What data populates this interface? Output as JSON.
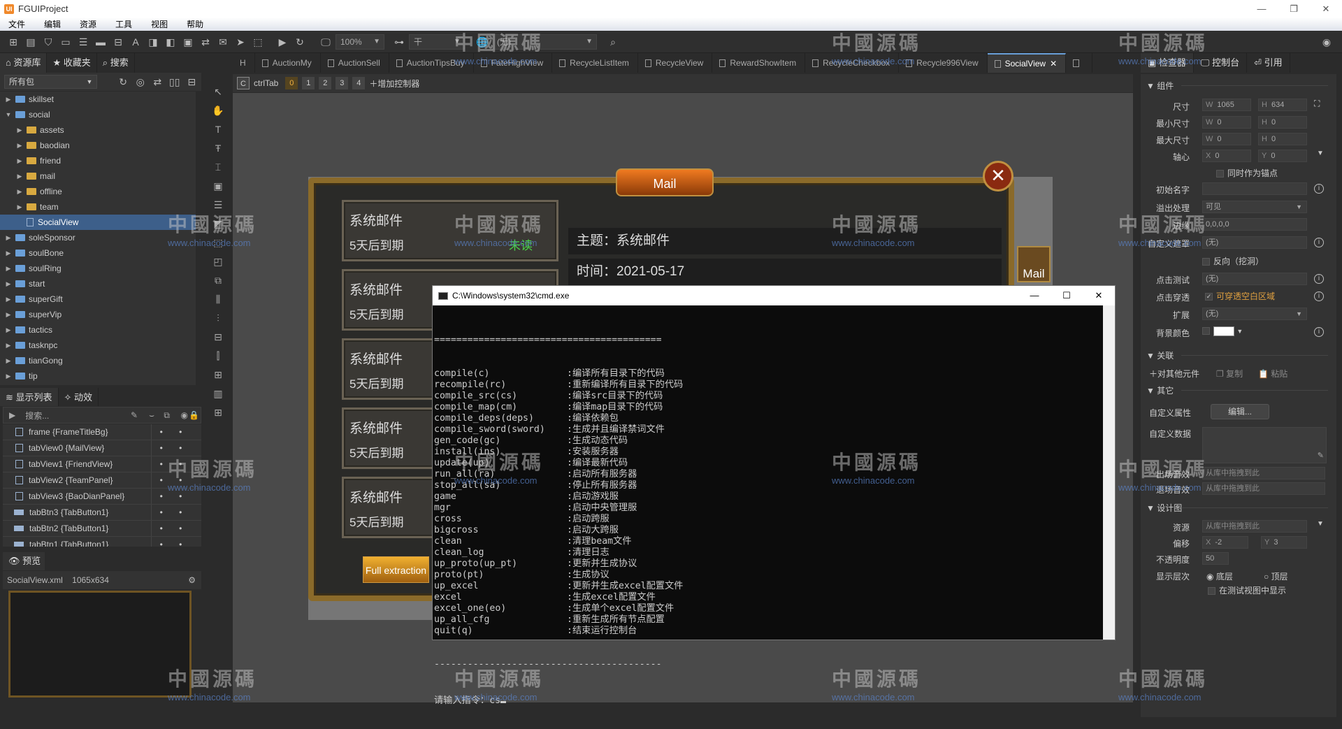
{
  "app": {
    "title": "FGUIProject",
    "logo": "UI",
    "window_controls": [
      "—",
      "❐",
      "✕"
    ]
  },
  "menu": [
    "文件",
    "编辑",
    "资源",
    "工具",
    "视图",
    "帮助"
  ],
  "toolbar": {
    "zoom": "100%",
    "lang": "(无)",
    "layout_label": "干"
  },
  "left": {
    "tabs": [
      "资源库",
      "收藏夹",
      "搜索"
    ],
    "package": "所有包",
    "tree": [
      {
        "label": "skillset",
        "level": 0,
        "type": "pkg",
        "exp": "▶"
      },
      {
        "label": "social",
        "level": 0,
        "type": "pkg",
        "exp": "▼"
      },
      {
        "label": "assets",
        "level": 1,
        "type": "folder",
        "exp": "▶"
      },
      {
        "label": "baodian",
        "level": 1,
        "type": "folder",
        "exp": "▶"
      },
      {
        "label": "friend",
        "level": 1,
        "type": "folder",
        "exp": "▶"
      },
      {
        "label": "mail",
        "level": 1,
        "type": "folder",
        "exp": "▶"
      },
      {
        "label": "offline",
        "level": 1,
        "type": "folder",
        "exp": "▶"
      },
      {
        "label": "team",
        "level": 1,
        "type": "folder",
        "exp": "▶"
      },
      {
        "label": "SocialView",
        "level": 1,
        "type": "file",
        "exp": "",
        "selected": true
      },
      {
        "label": "soleSponsor",
        "level": 0,
        "type": "pkg",
        "exp": "▶"
      },
      {
        "label": "soulBone",
        "level": 0,
        "type": "pkg",
        "exp": "▶"
      },
      {
        "label": "soulRing",
        "level": 0,
        "type": "pkg",
        "exp": "▶"
      },
      {
        "label": "start",
        "level": 0,
        "type": "pkg",
        "exp": "▶"
      },
      {
        "label": "superGift",
        "level": 0,
        "type": "pkg",
        "exp": "▶"
      },
      {
        "label": "superVip",
        "level": 0,
        "type": "pkg",
        "exp": "▶"
      },
      {
        "label": "tactics",
        "level": 0,
        "type": "pkg",
        "exp": "▶"
      },
      {
        "label": "tasknpc",
        "level": 0,
        "type": "pkg",
        "exp": "▶"
      },
      {
        "label": "tianGong",
        "level": 0,
        "type": "pkg",
        "exp": "▶"
      },
      {
        "label": "tip",
        "level": 0,
        "type": "pkg",
        "exp": "▶"
      }
    ],
    "display_tabs": [
      "显示列表",
      "动效"
    ],
    "search_placeholder": "搜索...",
    "display_list": [
      {
        "label": "frame {FrameTitleBg}",
        "icon": "bookmark"
      },
      {
        "label": "tabView0 {MailView}",
        "icon": "doc"
      },
      {
        "label": "tabView1 {FriendView}",
        "icon": "doc"
      },
      {
        "label": "tabView2 {TeamPanel}",
        "icon": "doc"
      },
      {
        "label": "tabView3 {BaoDianPanel}",
        "icon": "doc"
      },
      {
        "label": "tabBtn3 {TabButton1}",
        "icon": "btn"
      },
      {
        "label": "tabBtn2 {TabButton1}",
        "icon": "btn"
      },
      {
        "label": "tabBtn1 {TabButton1}",
        "icon": "btn"
      }
    ],
    "preview_tab": "预览",
    "preview_file": "SocialView.xml",
    "preview_size": "1065x634"
  },
  "doc_tabs": [
    {
      "label": "H"
    },
    {
      "label": "AuctionMy"
    },
    {
      "label": "AuctionSell"
    },
    {
      "label": "AuctionTipsBuy"
    },
    {
      "label": "FateHighView"
    },
    {
      "label": "RecycleListItem"
    },
    {
      "label": "RecycleView"
    },
    {
      "label": "RewardShowItem"
    },
    {
      "label": "RecycleCheckbox"
    },
    {
      "label": "Recycle996View"
    },
    {
      "label": "SocialView",
      "active": true,
      "close": "✕"
    },
    {
      "label": ""
    }
  ],
  "controller": {
    "name": "ctrlTab",
    "pages": [
      "0",
      "1",
      "2",
      "3",
      "4"
    ],
    "add_label": "增加控制器",
    "icon": "C"
  },
  "game": {
    "title": "Mail",
    "side_tab": "Mail",
    "close": "✕",
    "mails": [
      {
        "title": "系统邮件",
        "expire": "5天后到期",
        "status": "未读"
      },
      {
        "title": "系统邮件",
        "expire": "5天后到期"
      },
      {
        "title": "系统邮件",
        "expire": "5天后到期"
      },
      {
        "title": "系统邮件",
        "expire": "5天后到期"
      },
      {
        "title": "系统邮件",
        "expire": "5天后到期"
      }
    ],
    "subject": "主题：系统邮件",
    "time": "时间：2021-05-17",
    "button": "Full extraction"
  },
  "cmd": {
    "title": "C:\\Windows\\system32\\cmd.exe",
    "controls": [
      "—",
      "☐",
      "✕"
    ],
    "separator_top": "=========================================",
    "separator_bottom": "-----------------------------------------",
    "prompt": "请输入指令：cs",
    "commands": [
      [
        "compile(c)",
        ":编译所有目录下的代码"
      ],
      [
        "recompile(rc)",
        ":重新编译所有目录下的代码"
      ],
      [
        "compile_src(cs)",
        ":编译src目录下的代码"
      ],
      [
        "compile_map(cm)",
        ":编译map目录下的代码"
      ],
      [
        "compile_deps(deps)",
        ":编译依赖包"
      ],
      [
        "compile_sword(sword)",
        ":生成并且编译禁词文件"
      ],
      [
        "gen_code(gc)",
        ":生成动态代码"
      ],
      [
        "install(ins)",
        ":安装服务器"
      ],
      [
        "update(up)",
        ":编译最新代码"
      ],
      [
        "run_all(ra)",
        ":启动所有服务器"
      ],
      [
        "stop_all(sa)",
        ":停止所有服务器"
      ],
      [
        "game",
        ":启动游戏服"
      ],
      [
        "mgr",
        ":启动中央管理服"
      ],
      [
        "cross",
        ":启动跨服"
      ],
      [
        "bigcross",
        ":启动大跨服"
      ],
      [
        "clean",
        ":清理beam文件"
      ],
      [
        "clean_log",
        ":清理日志"
      ],
      [
        "up_proto(up_pt)",
        ":更新并生成协议"
      ],
      [
        "proto(pt)",
        ":生成协议"
      ],
      [
        "up_excel",
        ":更新并生成excel配置文件"
      ],
      [
        "excel",
        ":生成excel配置文件"
      ],
      [
        "excel_one(eo)",
        ":生成单个excel配置文件"
      ],
      [
        "up_all_cfg",
        ":重新生成所有节点配置"
      ],
      [
        "quit(q)",
        ":结束运行控制台"
      ]
    ]
  },
  "inspector": {
    "tabs": [
      "检查器",
      "控制台",
      "引用"
    ],
    "sec_component": "组件",
    "size_label": "尺寸",
    "w": "1065",
    "h": "634",
    "min_label": "最小尺寸",
    "min_w": "0",
    "min_h": "0",
    "max_label": "最大尺寸",
    "max_w": "0",
    "max_h": "0",
    "pivot_label": "轴心",
    "pivot_x": "0",
    "pivot_y": "0",
    "anchor_label": "同时作为锚点",
    "init_name_label": "初始名字",
    "overflow_label": "溢出处理",
    "overflow": "可见",
    "margin_label": "边缘",
    "margin": "0,0,0,0",
    "mask_label": "自定义遮罩",
    "mask": "(无)",
    "reverse_label": "反向（挖洞）",
    "hittest_label": "点击测试",
    "hittest": "(无)",
    "through_label": "点击穿透",
    "through": "可穿透空白区域",
    "extend_label": "扩展",
    "extend": "(无)",
    "bg_label": "背景颜色",
    "bg_color": "#ffffff",
    "sec_relation": "关联",
    "rel_add": "对其他元件",
    "rel_copy": "复制",
    "rel_paste": "粘贴",
    "sec_other": "其它",
    "custom_prop_label": "自定义属性",
    "edit_btn": "编辑...",
    "custom_data_label": "自定义数据",
    "enter_sound_label": "出场音效",
    "enter_sound": "从库中拖拽到此",
    "exit_sound_label": "退场音效",
    "exit_sound": "从库中拖拽到此",
    "sec_design": "设计图",
    "res_label": "资源",
    "res": "从库中拖拽到此",
    "offset_label": "偏移",
    "off_x": "-2",
    "off_y": "3",
    "opacity_label": "不透明度",
    "opacity": "50",
    "layer_label": "显示层次",
    "layer_bottom": "底层",
    "layer_top": "顶层",
    "show_test_label": "在测试视图中显示"
  },
  "watermark": {
    "text": "中國源碼",
    "url": "www.chinacode.com"
  }
}
